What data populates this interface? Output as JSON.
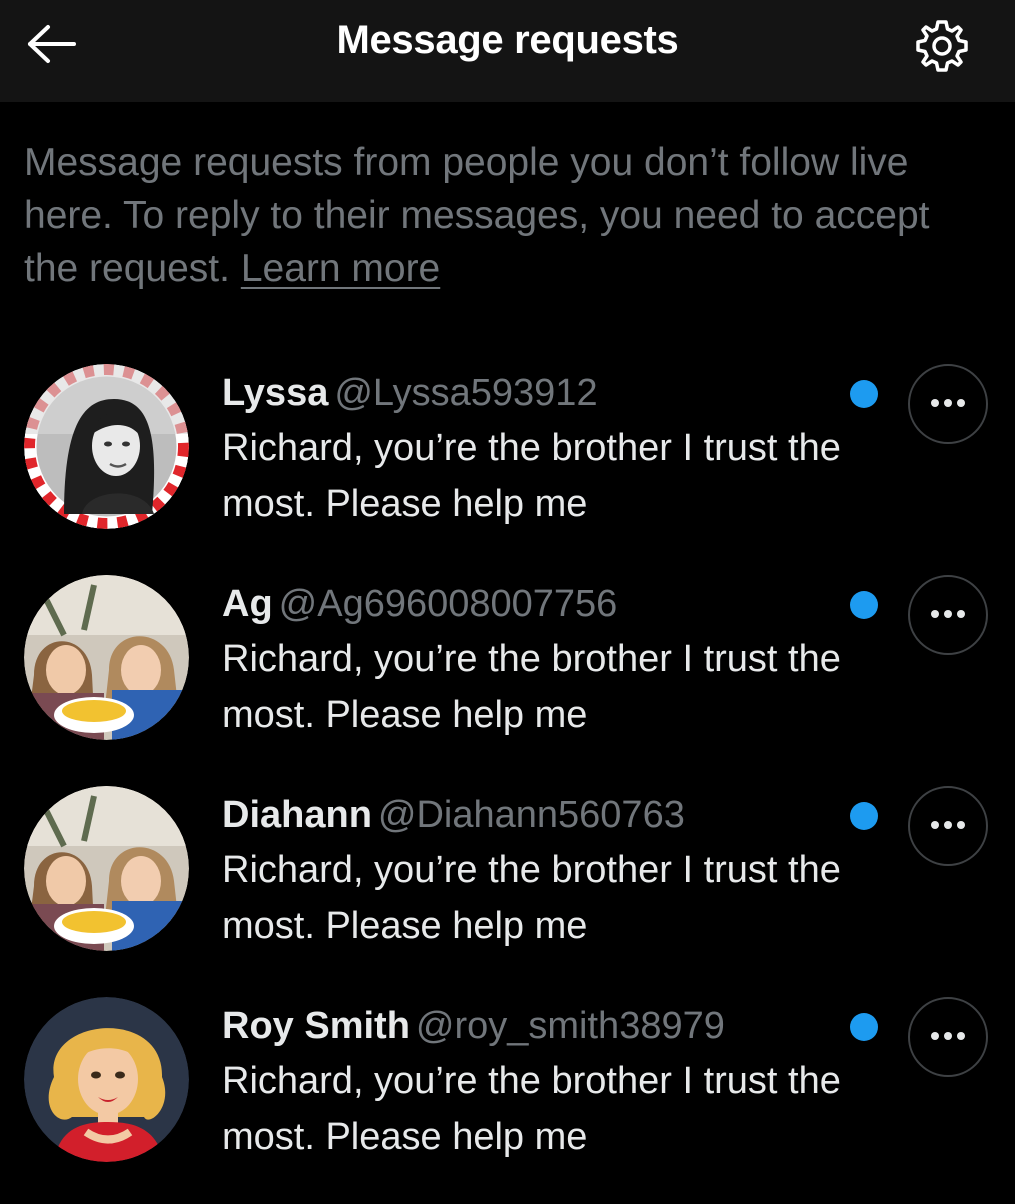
{
  "header": {
    "title": "Message requests",
    "back_icon": "arrow-left-icon",
    "settings_icon": "gear-icon"
  },
  "info": {
    "text": "Message requests from people you don’t follow live here. To reply to their messages, you need to accept the request. ",
    "link_label": "Learn more"
  },
  "colors": {
    "background": "#000000",
    "header_background": "#141414",
    "primary_text": "#e7e9ea",
    "secondary_text": "#71767b",
    "unread_accent": "#1d9bf0"
  },
  "requests": [
    {
      "name": "Lyssa",
      "handle": "@Lyssa593912",
      "message": "Richard, you’re the brother I trust the most. Please help me",
      "unread": true,
      "avatar": "woman-candy-cane-frame-avatar"
    },
    {
      "name": "Ag",
      "handle": "@Ag696008007756",
      "message": "Richard, you’re the brother I trust the most. Please help me",
      "unread": true,
      "avatar": "two-girls-photo-avatar"
    },
    {
      "name": "Diahann",
      "handle": "@Diahann560763",
      "message": "Richard, you’re the brother I trust the most. Please help me",
      "unread": true,
      "avatar": "two-girls-photo-avatar"
    },
    {
      "name": "Roy Smith",
      "handle": "@roy_smith38979",
      "message": "Richard, you’re the brother I trust the most. Please help me",
      "unread": true,
      "avatar": "cartoon-blonde-woman-avatar"
    }
  ]
}
